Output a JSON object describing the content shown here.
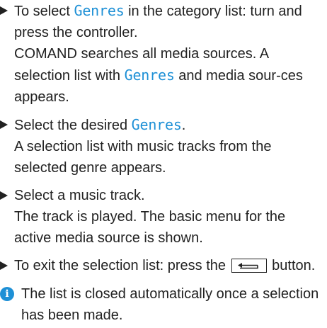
{
  "steps": [
    {
      "lines": [
        {
          "pre": "To select ",
          "kw": "Genres",
          "post": " in the category list: turn and press the controller."
        },
        {
          "text": "COMAND searches all media sources. A selection list with "
        },
        {
          "kw": "Genres",
          "post": " and media sources appears."
        }
      ]
    }
  ],
  "step1": {
    "pre": "To select ",
    "kw": "Genres",
    "post": " in the category list: turn and press the controller.",
    "result_pre": "COMAND searches all media sources. A selection list with ",
    "result_kw": "Genres",
    "result_post": " and media sour-ces appears."
  },
  "step2": {
    "pre": "Select the desired ",
    "kw": "Genres",
    "post": ".",
    "result": "A selection list with music tracks from the selected genre appears."
  },
  "step3": {
    "text": "Select a music track.",
    "result": "The track is played. The basic menu for the active media source is shown."
  },
  "step4": {
    "pre": "To exit the selection list: press the",
    "icon": "back-arrow-icon",
    "post": "button."
  },
  "info": {
    "icon": "info-icon",
    "symbol": "i",
    "text": "The list is closed automatically once a selection has been made."
  },
  "colors": {
    "accent": "#1e90d6",
    "text": "#222222"
  }
}
